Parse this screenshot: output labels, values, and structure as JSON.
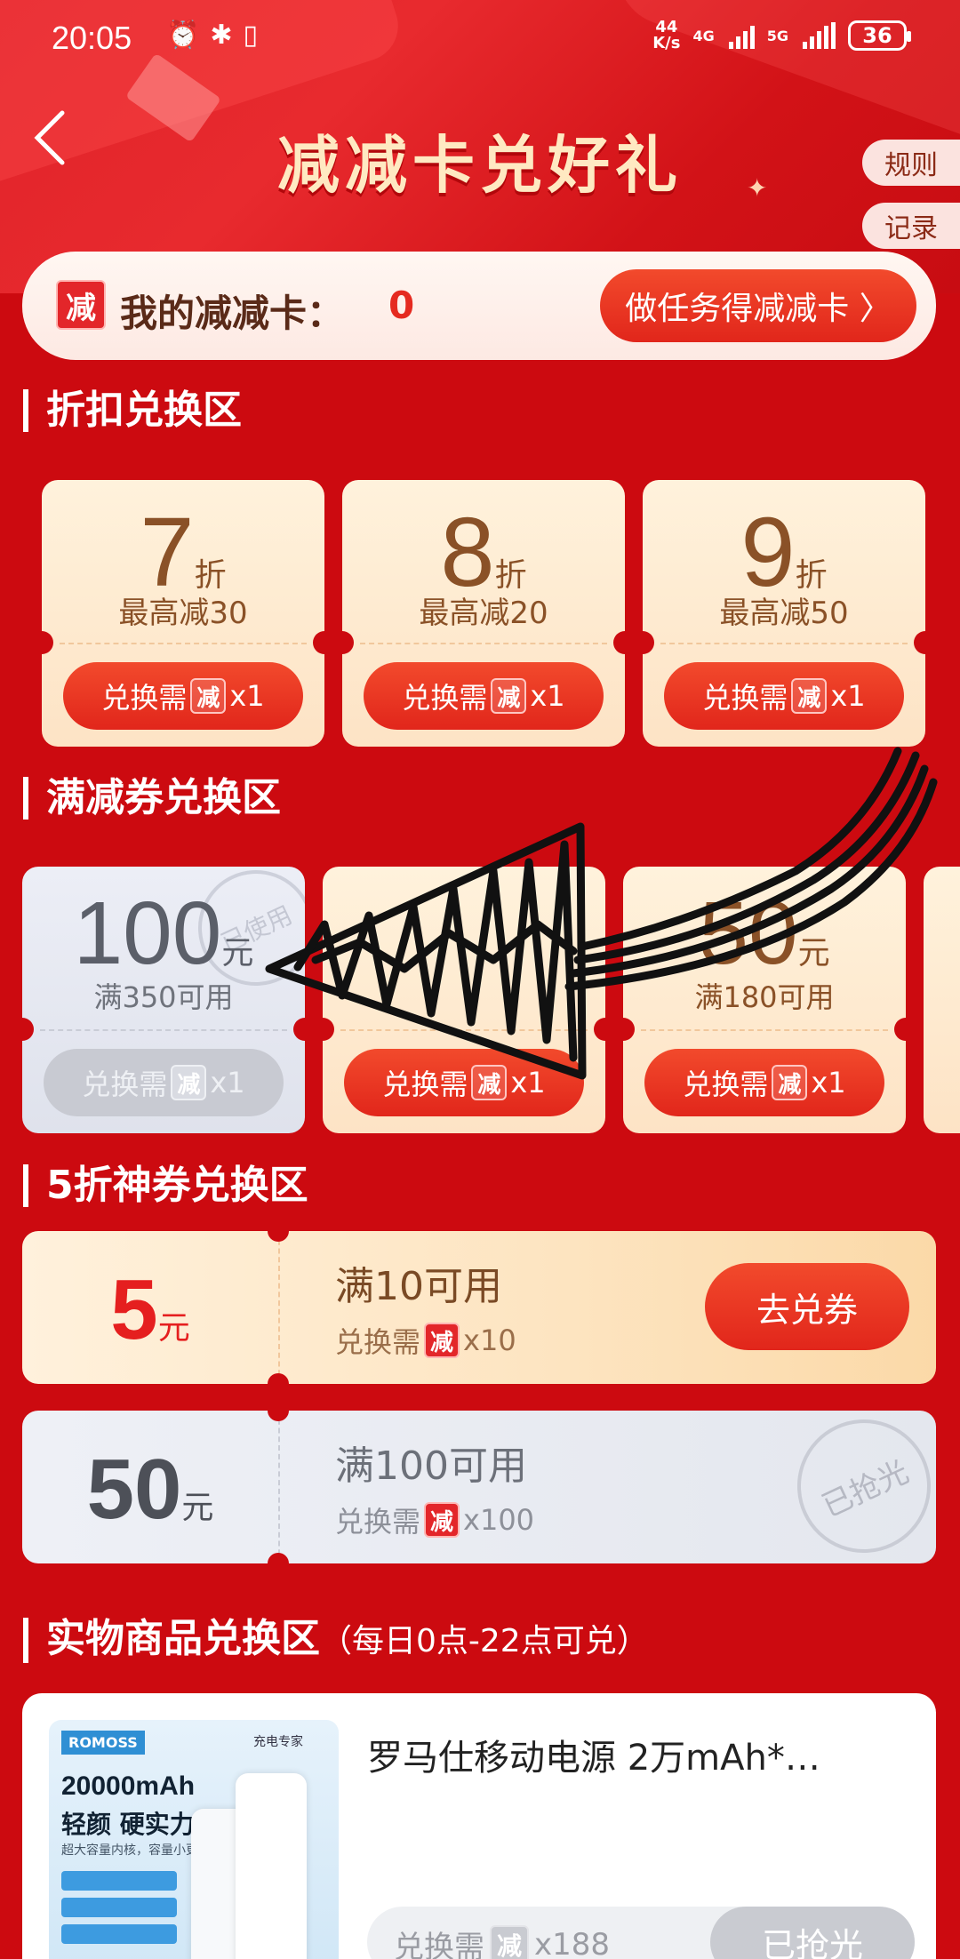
{
  "status": {
    "time": "20:05",
    "icons_left": [
      "alarm-icon",
      "bluetooth-icon",
      "vibrate-icon"
    ],
    "net_speed_value": "44",
    "net_speed_unit": "K/s",
    "sig1_label": "4G",
    "sig2_label": "5G",
    "battery": "36"
  },
  "header": {
    "title": "减减卡兑好礼",
    "rules_label": "规则",
    "record_label": "记录"
  },
  "card": {
    "badge": "减",
    "label": "我的减减卡：",
    "count": "0",
    "task_button": "做任务得减减卡 〉"
  },
  "common": {
    "exchange_prefix": "兑换需",
    "badge": "减"
  },
  "discount_section": {
    "title": "折扣兑换区",
    "items": [
      {
        "num": "7",
        "unit": "折",
        "desc": "最高减30",
        "qty": "x1"
      },
      {
        "num": "8",
        "unit": "折",
        "desc": "最高减20",
        "qty": "x1"
      },
      {
        "num": "9",
        "unit": "折",
        "desc": "最高减50",
        "qty": "x1"
      }
    ]
  },
  "coupon_section": {
    "title": "满减券兑换区",
    "items": [
      {
        "amount": "100",
        "unit": "元",
        "cond": "满350可用",
        "qty": "x1",
        "state": "used",
        "stamp": "已使用"
      },
      {
        "amount": "",
        "unit": "",
        "cond": "",
        "qty": "x1",
        "state": "active"
      },
      {
        "amount": "50",
        "unit": "元",
        "cond": "满180可用",
        "qty": "x1",
        "state": "active"
      }
    ]
  },
  "half_section": {
    "title": "5折神券兑换区",
    "items": [
      {
        "amount": "5",
        "unit": "元",
        "cond": "满10可用",
        "qty": "x10",
        "button": "去兑券",
        "state": "active"
      },
      {
        "amount": "50",
        "unit": "元",
        "cond": "满100可用",
        "qty": "x100",
        "stamp": "已抢光",
        "state": "soldout"
      }
    ]
  },
  "product_section": {
    "title": "实物商品兑换区",
    "note": "（每日0点-22点可兑）",
    "product": {
      "name": "罗马仕移动电源 2万mAh*…",
      "img_brand": "ROMOSS",
      "img_badge": "充电专家",
      "img_capacity": "20000mAh",
      "img_slogan": "轻颜 硬实力",
      "img_sub": "超大容量内核，容量小更轻",
      "qty": "x188",
      "button": "已抢光"
    }
  },
  "colors": {
    "page_bg": "#cc0a10",
    "accent_red": "#e1261b",
    "gold_text": "#8a5127",
    "title_gold": "#ffe9c2"
  }
}
